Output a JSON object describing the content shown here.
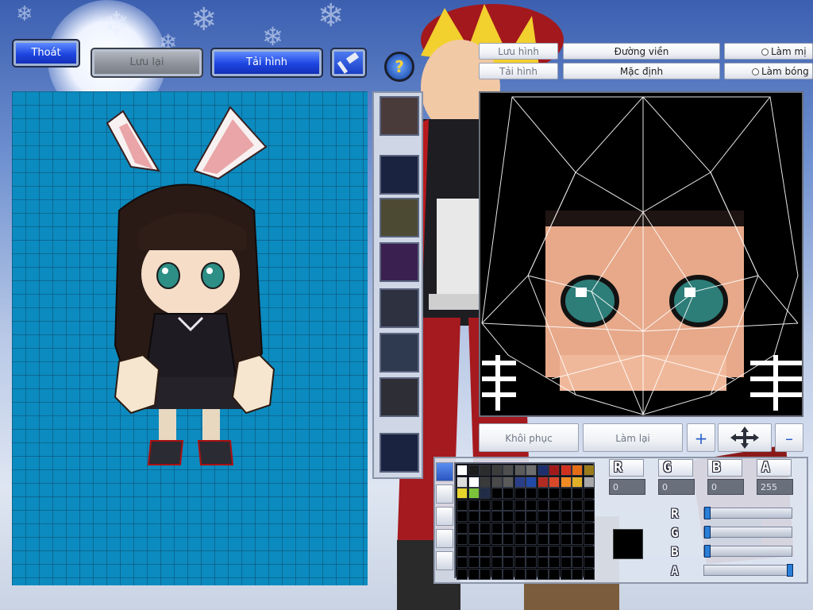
{
  "toolbar": {
    "exit_label": "Thoát",
    "save_label": "Lưu lại",
    "reload_label": "Tải hình"
  },
  "texture_panel": {
    "save_image_label": "Lưu hình",
    "outline_label": "Đường viền",
    "reload_image_label": "Tải hình",
    "default_label": "Mặc định",
    "radio1_label": "Làm mị",
    "radio2_label": "Làm bóng",
    "restore_label": "Khôi phục",
    "redo_label": "Làm lại"
  },
  "color_editor": {
    "channels": [
      {
        "label": "R",
        "value": "0"
      },
      {
        "label": "G",
        "value": "0"
      },
      {
        "label": "B",
        "value": "0"
      },
      {
        "label": "A",
        "value": "255"
      }
    ],
    "slider_labels": [
      "R",
      "G",
      "B",
      "A"
    ],
    "slider_values": [
      0,
      0,
      0,
      1
    ],
    "current_color": "#000000",
    "palette_row1": [
      "#ffffff",
      "#1c1c1c",
      "#2c2c2c",
      "#3c3c3c",
      "#4e4e4e",
      "#5c5c5c",
      "#6e6e6e",
      "#1d2f6e",
      "#a11a1a",
      "#d0321f",
      "#e46d18",
      "#9b7b1a"
    ],
    "palette_row2": [
      "#dcdcdc",
      "#ffffff",
      "#3a3a3a",
      "#4a4a4a",
      "#5a5a5a",
      "#2a3e88",
      "#224aa8",
      "#b22b22",
      "#d8492a",
      "#f08a22",
      "#e0b028",
      "#a8a8a8"
    ],
    "palette_row3": [
      "#e8d22c",
      "#7cc23a",
      "#202c48"
    ]
  },
  "icons": {
    "help": "help-icon",
    "hammer": "hammer-icon",
    "move": "move-arrows-icon"
  }
}
